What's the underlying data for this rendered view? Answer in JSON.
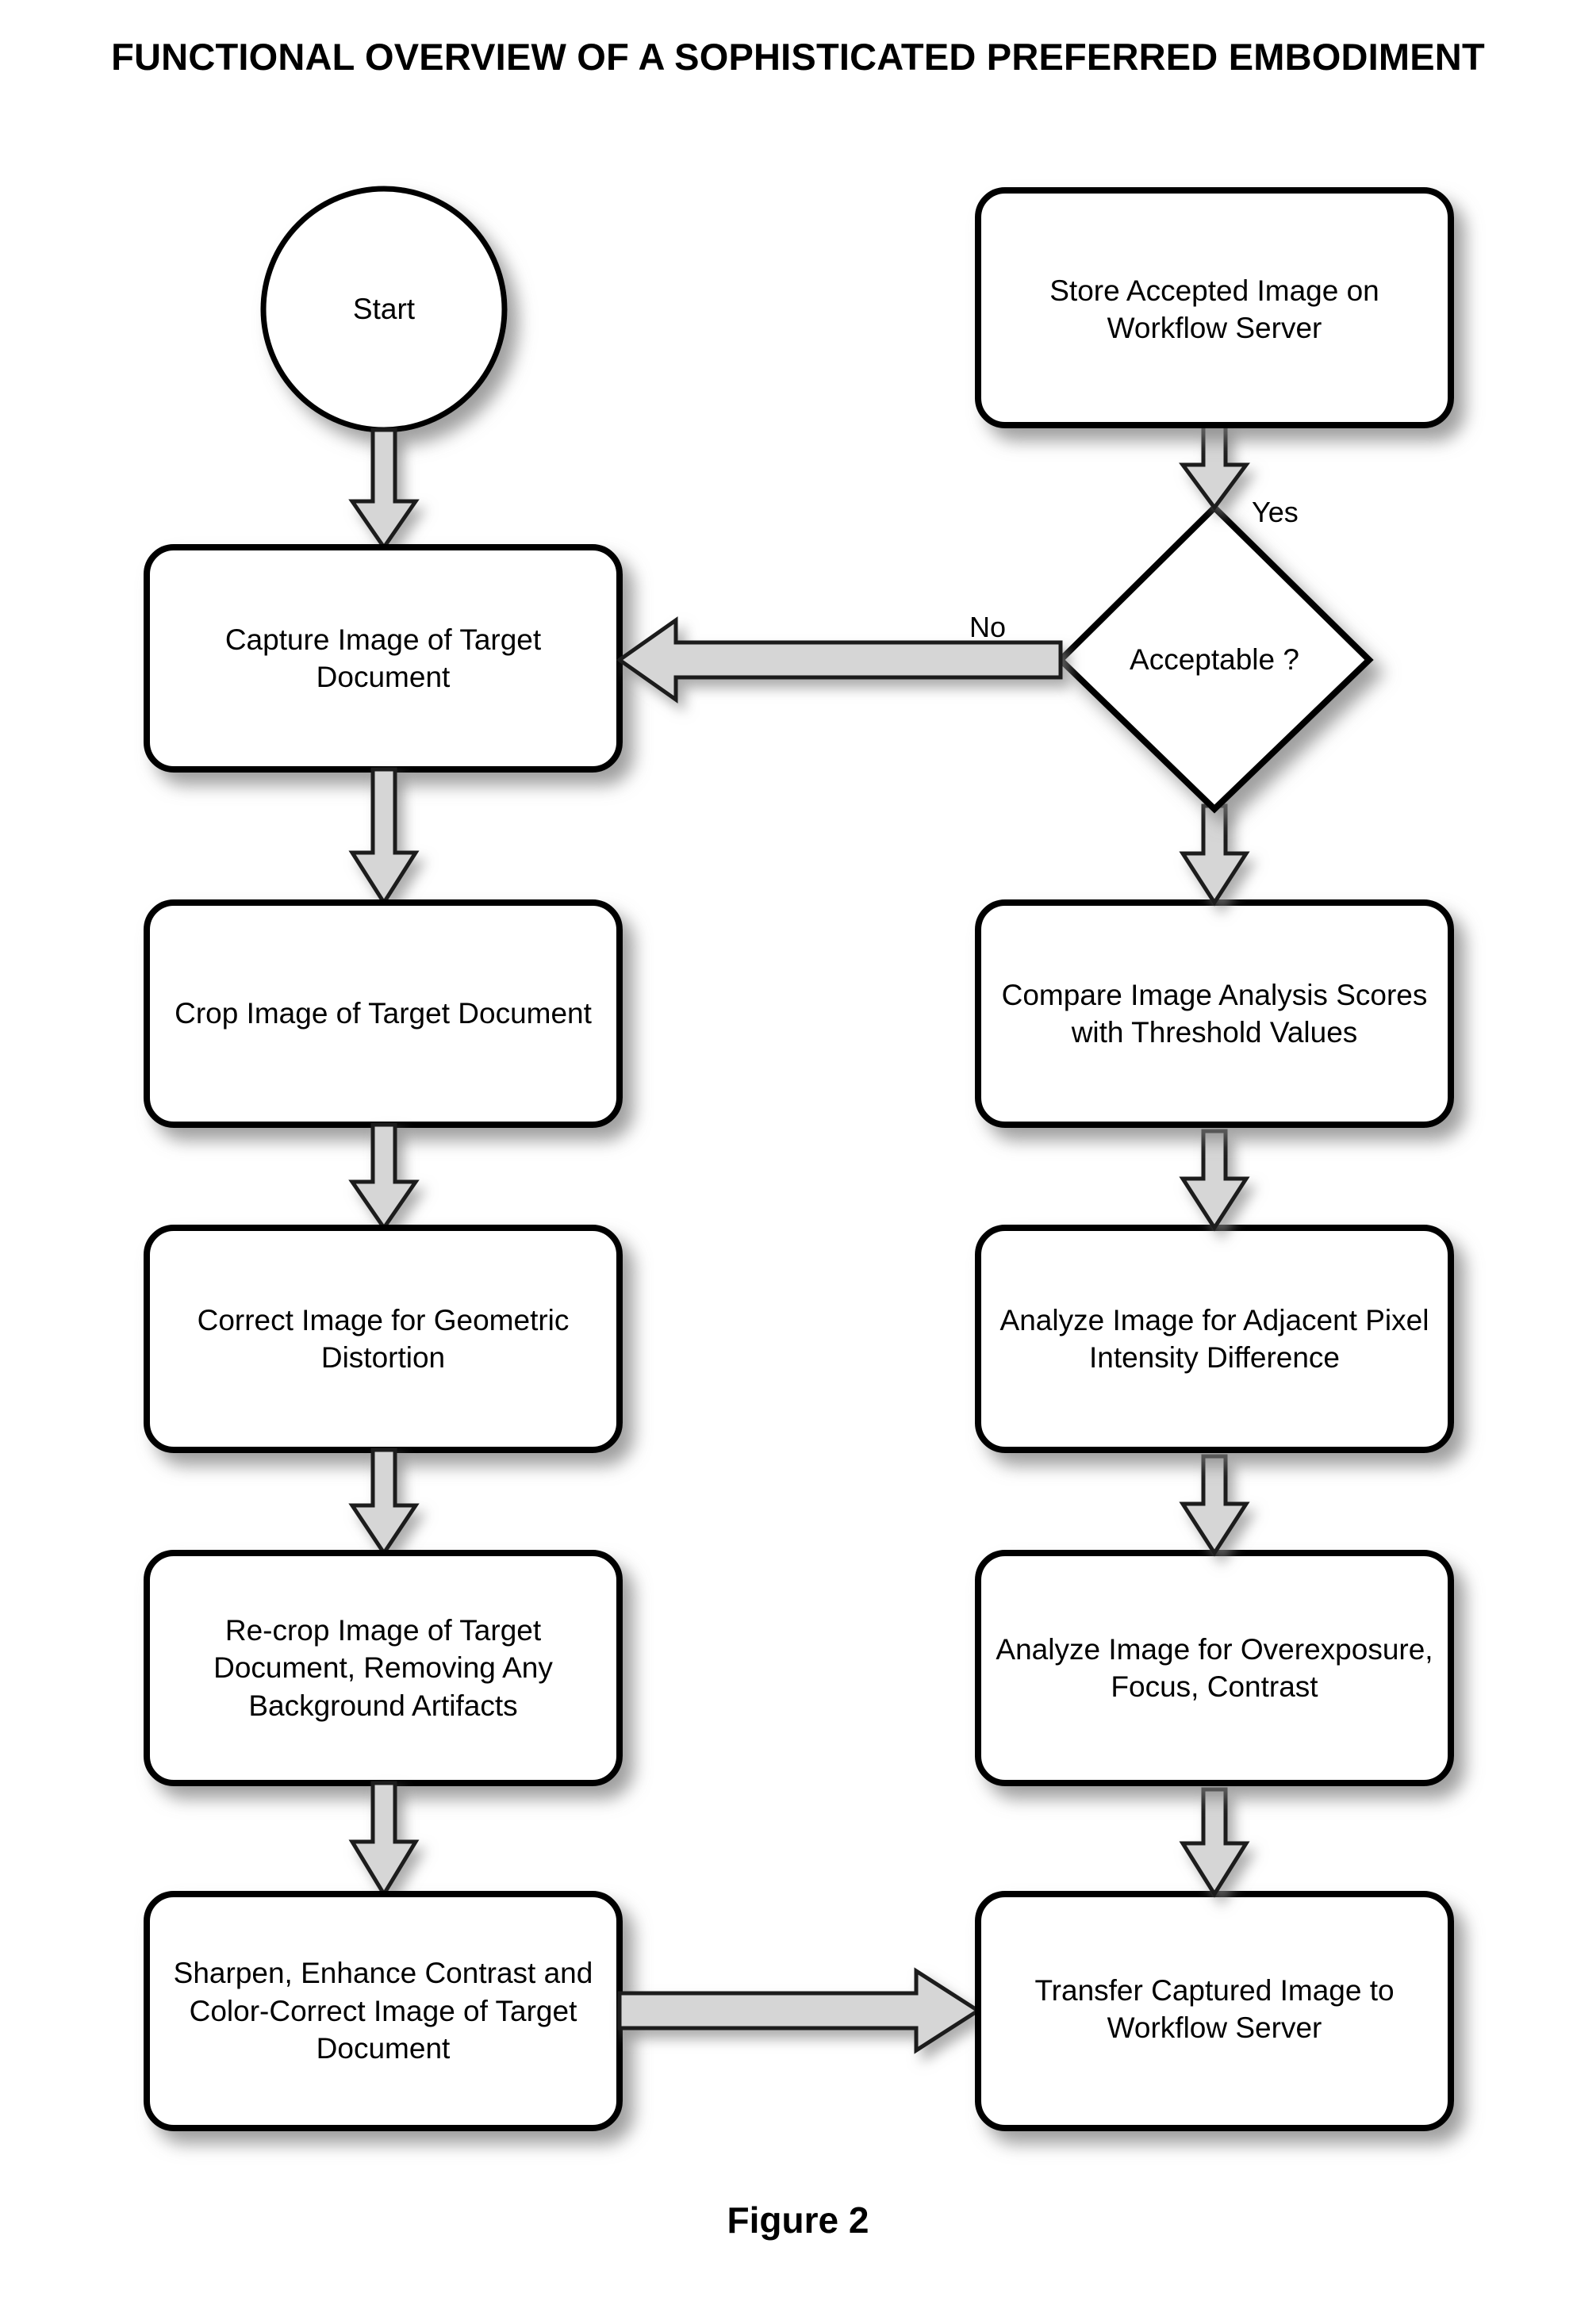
{
  "figure": {
    "title": "FUNCTIONAL OVERVIEW OF A SOPHISTICATED PREFERRED EMBODIMENT",
    "caption": "Figure 2"
  },
  "diagram": {
    "type": "flowchart",
    "nodes": [
      {
        "id": "start",
        "shape": "circle",
        "label": "Start"
      },
      {
        "id": "capture",
        "shape": "process",
        "label": "Capture Image of Target Document"
      },
      {
        "id": "crop",
        "shape": "process",
        "label": "Crop Image of Target Document"
      },
      {
        "id": "correct",
        "shape": "process",
        "label": "Correct Image for Geometric Distortion"
      },
      {
        "id": "recrop",
        "shape": "process",
        "label": "Re-crop Image of Target Document, Removing Any Background Artifacts"
      },
      {
        "id": "sharpen",
        "shape": "process",
        "label": "Sharpen, Enhance Contrast and Color-Correct Image of Target Document"
      },
      {
        "id": "transfer",
        "shape": "process",
        "label": "Transfer Captured Image to Workflow Server"
      },
      {
        "id": "analyze_expo",
        "shape": "process",
        "label": "Analyze Image for Overexposure, Focus, Contrast"
      },
      {
        "id": "analyze_pix",
        "shape": "process",
        "label": "Analyze Image for Adjacent Pixel Intensity Difference"
      },
      {
        "id": "compare",
        "shape": "process",
        "label": "Compare Image Analysis Scores with Threshold Values"
      },
      {
        "id": "acceptable",
        "shape": "decision",
        "label": "Acceptable ?"
      },
      {
        "id": "store",
        "shape": "process",
        "label": "Store Accepted Image on Workflow Server"
      }
    ],
    "edges": [
      {
        "from": "start",
        "to": "capture",
        "label": "",
        "direction": "down"
      },
      {
        "from": "capture",
        "to": "crop",
        "label": "",
        "direction": "down"
      },
      {
        "from": "crop",
        "to": "correct",
        "label": "",
        "direction": "down"
      },
      {
        "from": "correct",
        "to": "recrop",
        "label": "",
        "direction": "down"
      },
      {
        "from": "recrop",
        "to": "sharpen",
        "label": "",
        "direction": "down"
      },
      {
        "from": "sharpen",
        "to": "transfer",
        "label": "",
        "direction": "right"
      },
      {
        "from": "transfer",
        "to": "analyze_expo",
        "label": "",
        "direction": "up"
      },
      {
        "from": "analyze_expo",
        "to": "analyze_pix",
        "label": "",
        "direction": "up"
      },
      {
        "from": "analyze_pix",
        "to": "compare",
        "label": "",
        "direction": "up"
      },
      {
        "from": "compare",
        "to": "acceptable",
        "label": "",
        "direction": "up"
      },
      {
        "from": "acceptable",
        "to": "store",
        "label": "Yes",
        "direction": "up"
      },
      {
        "from": "acceptable",
        "to": "capture",
        "label": "No",
        "direction": "left"
      }
    ],
    "edge_labels": {
      "yes": "Yes",
      "no": "No"
    },
    "colors": {
      "stroke": "#000000",
      "fill": "#ffffff",
      "shadow": "#9a9a9a",
      "arrow_fill": "#d2d2d2",
      "background": "#ffffff"
    }
  }
}
